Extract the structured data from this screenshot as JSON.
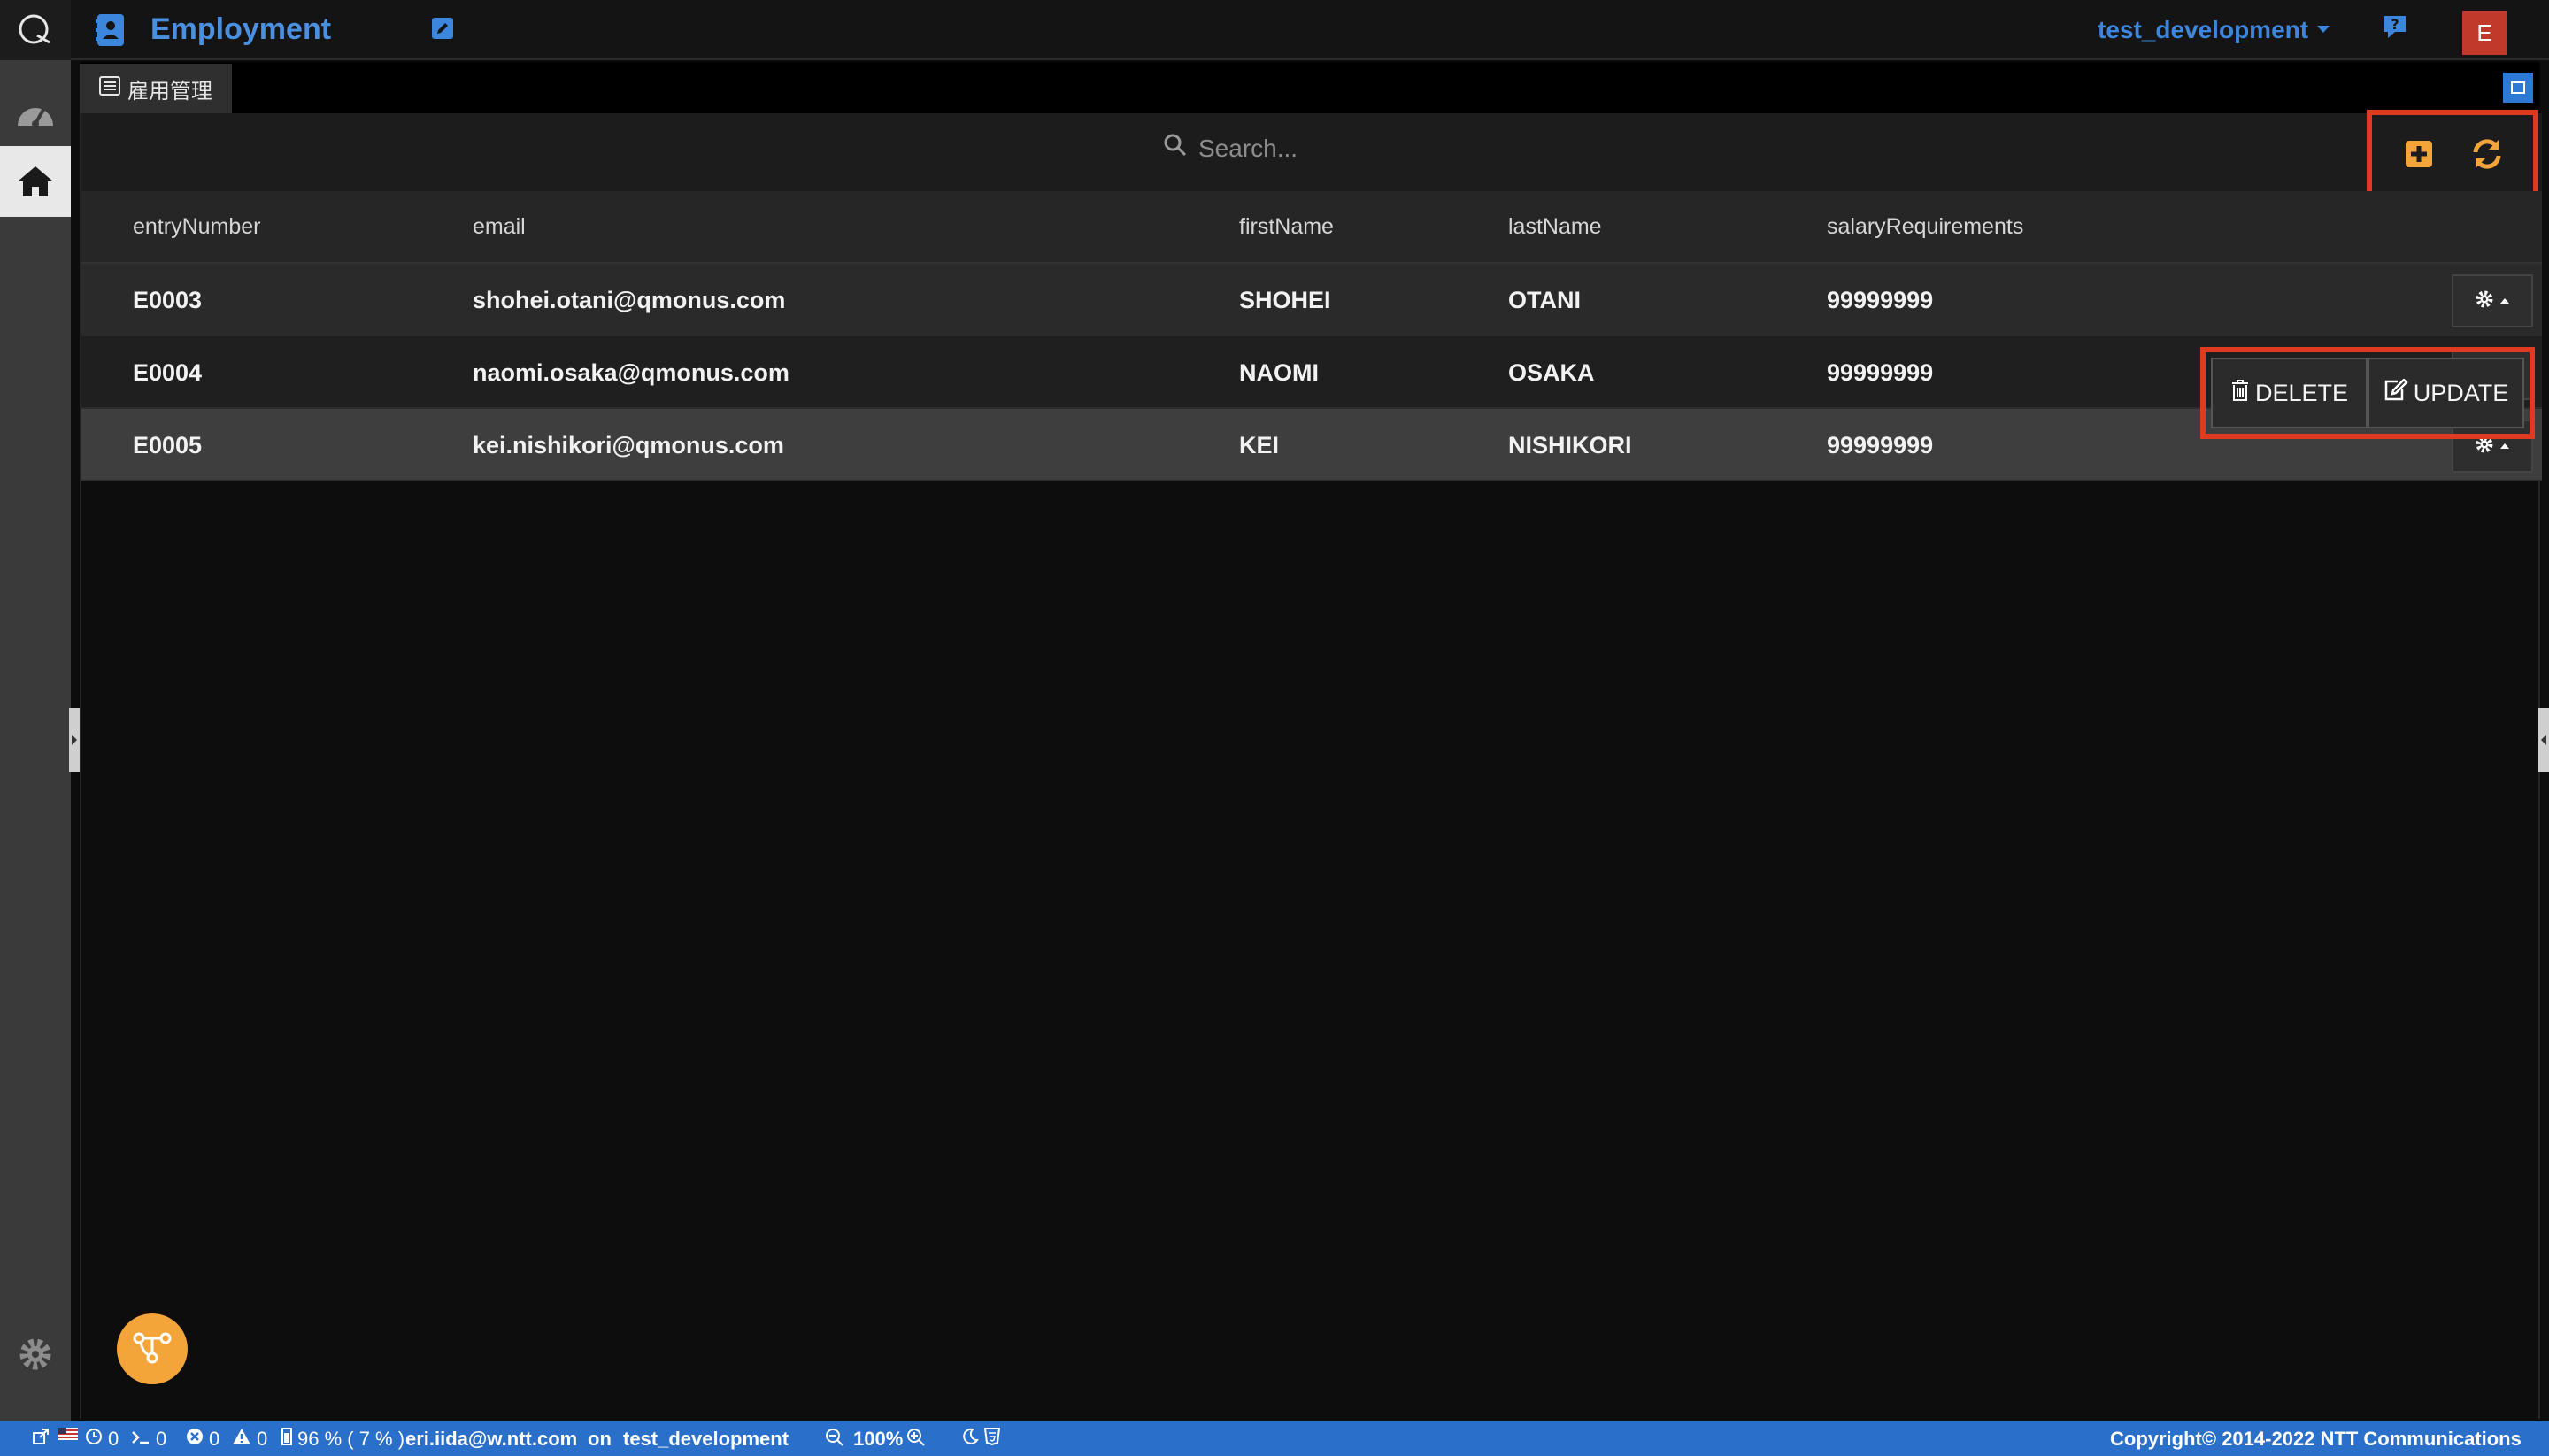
{
  "header": {
    "app_title": "Employment",
    "environment": "test_development",
    "avatar_letter": "E"
  },
  "tab": {
    "label": "雇用管理"
  },
  "search": {
    "placeholder": "Search..."
  },
  "table": {
    "columns": [
      "entryNumber",
      "email",
      "firstName",
      "lastName",
      "salaryRequirements"
    ],
    "rows": [
      [
        "E0003",
        "shohei.otani@qmonus.com",
        "SHOHEI",
        "OTANI",
        "99999999"
      ],
      [
        "E0004",
        "naomi.osaka@qmonus.com",
        "NAOMI",
        "OSAKA",
        "99999999"
      ],
      [
        "E0005",
        "kei.nishikori@qmonus.com",
        "KEI",
        "NISHIKORI",
        "99999999"
      ]
    ]
  },
  "row_actions": {
    "delete_label": "DELETE",
    "update_label": "UPDATE"
  },
  "status": {
    "clock_count": "0",
    "terminal_count": "0",
    "error_count": "0",
    "warning_count": "0",
    "memory": "96 % ( 7 % )",
    "user": "eri.iida@w.ntt.com",
    "on_label": "on",
    "environment": "test_development",
    "zoom": "100%",
    "copyright": "Copyright© 2014-2022 NTT Communications"
  },
  "colors": {
    "accent_blue": "#3d86dd",
    "accent_orange": "#f4a53a",
    "highlight_red": "#e03a21",
    "statusbar_blue": "#2a6fca"
  }
}
